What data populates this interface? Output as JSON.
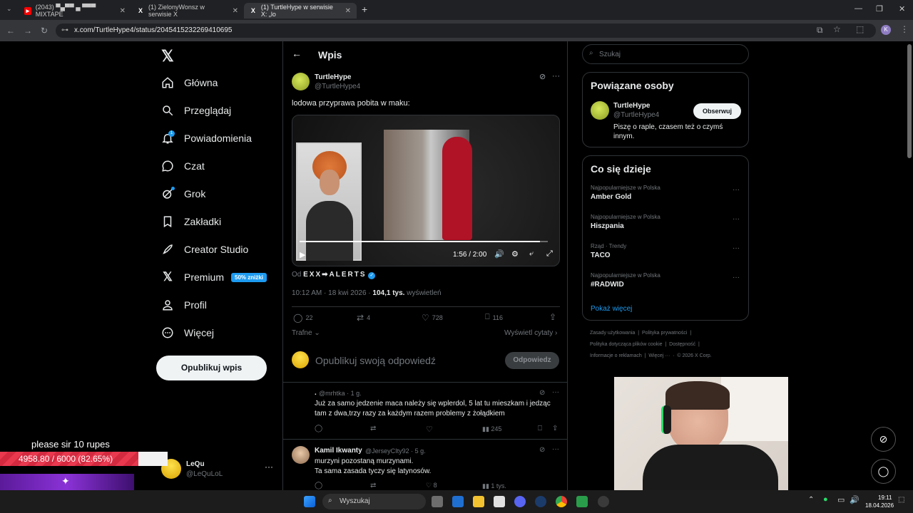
{
  "browser": {
    "tabs": [
      {
        "title": "(2043) ▀▄▀▀ ▄ ▀▀▀ MIXTAPE",
        "active": false
      },
      {
        "title": "(1) ZielonyWonsz w serwisie X",
        "active": false
      },
      {
        "title": "(1) TurtleHype w serwisie X: „lo",
        "active": true
      }
    ],
    "url": "x.com/TurtleHype4/status/2045415232269410695"
  },
  "nav": {
    "items": [
      "Główna",
      "Przeglądaj",
      "Powiadomienia",
      "Czat",
      "Grok",
      "Zakładki",
      "Creator Studio",
      "Premium",
      "Profil",
      "Więcej"
    ],
    "premium_badge": "50% zniżki",
    "notif_count": "1",
    "post_button": "Opublikuj wpis",
    "account": {
      "name": "LeQu",
      "handle": "@LeQuLoL"
    }
  },
  "post": {
    "header": "Wpis",
    "author": "TurtleHype",
    "handle": "@TurtleHype4",
    "text": "lodowa przyprawa pobita w maku:",
    "video_time": "1:56 / 2:00",
    "video_progress": 0.967,
    "source_prefix": "Od",
    "source_name": "EXX➡ALERTS",
    "timestamp": "10:12 AM · 18 kwi 2026 · ",
    "views_count": "104,1 tys.",
    "views_label": " wyświetleń",
    "replies": "22",
    "reposts": "4",
    "likes": "728",
    "bookmarks": "116",
    "sort_label": "Trafne",
    "quotes_link": "Wyświetl cytaty",
    "reply_placeholder": "Opublikuj swoją odpowiedź",
    "reply_button": "Odpowiedz"
  },
  "replies": [
    {
      "name": ".",
      "handle": "@mrhtka · 1 g.",
      "text1": "Już za samo jedzenie maca należy się wplerdol, 5 lat tu mieszkam i jedząc",
      "text2": "tam z dwa,trzy razy za każdym razem problemy z żołądkiem",
      "views": "245",
      "likes": "",
      "retweets": ""
    },
    {
      "name": "Kamil Ikwanty",
      "handle": "@JerseyCIty92 · 5 g.",
      "text1": "murzyni pozostaną murzynami.",
      "text2": "Ta sama zasada tyczy się latynosów.",
      "views": "1 tys.",
      "likes": "8",
      "retweets": ""
    }
  ],
  "right": {
    "search_placeholder": "Szukaj",
    "related_title": "Powiązane osoby",
    "related_name": "TurtleHype",
    "related_handle": "@TurtleHype4",
    "related_bio1": "Piszę o raple, czasem też o czymś",
    "related_bio2": "innym.",
    "follow": "Obserwuj",
    "trends_title": "Co się dzieje",
    "trends": [
      {
        "cat": "Najpopularniejsze w Polska",
        "name": "Amber Gold"
      },
      {
        "cat": "Najpopularniejsze w Polska",
        "name": "Hiszpania"
      },
      {
        "cat": "Rząd · Trendy",
        "name": "TACO"
      },
      {
        "cat": "Najpopularniejsze w Polska",
        "name": "#RADWID"
      }
    ],
    "show_more": "Pokaż więcej",
    "footer1": "Zasady użytkowania  |  Polityka prywatności  |",
    "footer2": "Polityka dotycząca plików cookie  |  Dostępność  |",
    "footer3": "Informacje o reklamach  |  Więcej ···  ·  © 2026 X Corp."
  },
  "overlay": {
    "donation_text": "please sir 10 rupes",
    "goal_text": "4958.80 / 6000 (82.65%)",
    "goal_fraction": 0.8265
  },
  "taskbar": {
    "search": "Wyszukaj",
    "time": "19:11",
    "date": "18.04.2026"
  }
}
